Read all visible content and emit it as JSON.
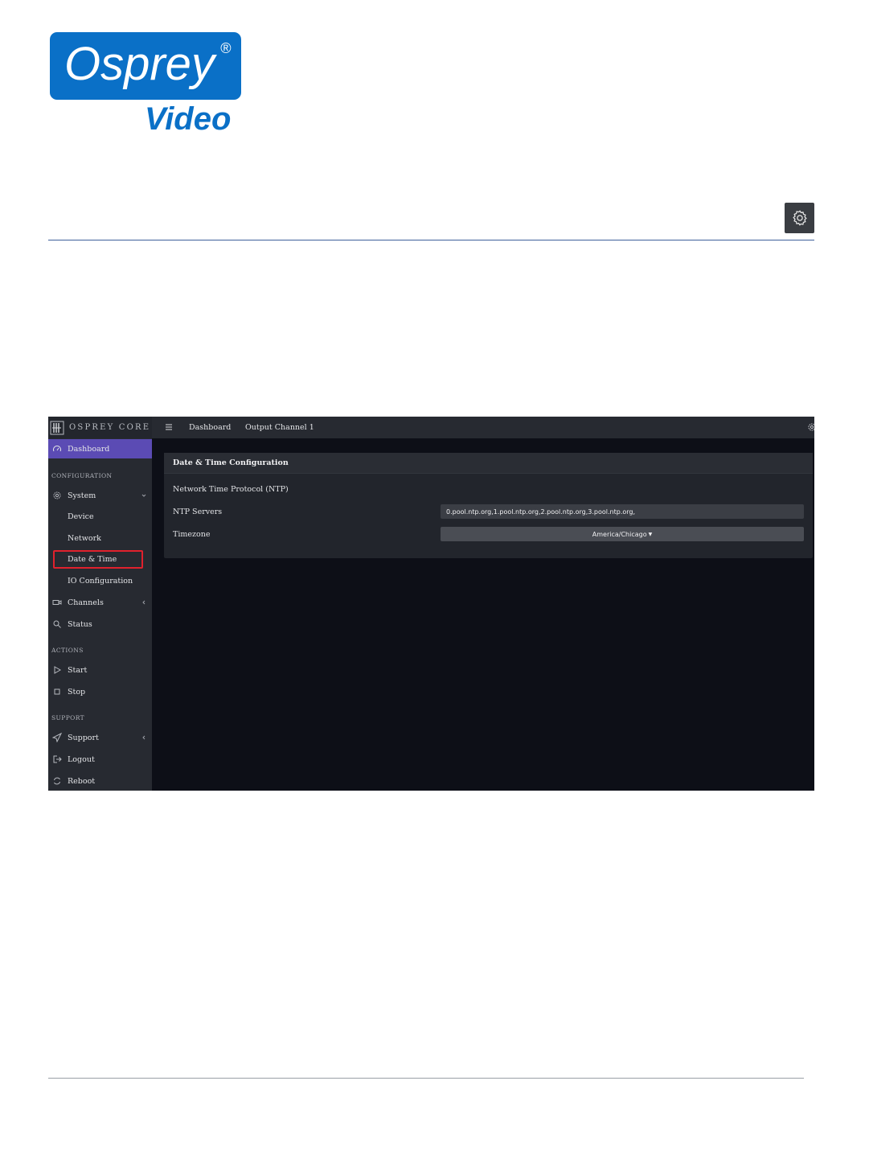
{
  "logo": {
    "primary": "Osprey",
    "registered": "®",
    "secondary": "Video"
  },
  "colors": {
    "brand_blue": "#0a70c7",
    "active_nav": "#5b4bb4",
    "highlight": "#e0212d"
  },
  "app": {
    "brand": "OSPREY CORE",
    "topbar": {
      "menu_icon": "hamburger-icon",
      "tabs": [
        "Dashboard",
        "Output Channel 1"
      ],
      "settings_icon": "gear-icon"
    },
    "sidebar": {
      "dashboard": "Dashboard",
      "sections": {
        "configuration": "CONFIGURATION",
        "actions": "ACTIONS",
        "support": "SUPPORT"
      },
      "system": "System",
      "system_children": [
        "Device",
        "Network",
        "Date & Time",
        "IO Configuration"
      ],
      "channels": "Channels",
      "status": "Status",
      "start": "Start",
      "stop": "Stop",
      "support_item": "Support",
      "logout": "Logout",
      "reboot": "Reboot"
    },
    "panel": {
      "title": "Date & Time Configuration",
      "ntp_heading": "Network Time Protocol (NTP)",
      "ntp_servers_label": "NTP Servers",
      "ntp_servers_value": "0.pool.ntp.org,1.pool.ntp.org,2.pool.ntp.org,3.pool.ntp.org,",
      "timezone_label": "Timezone",
      "timezone_value": "America/Chicago"
    }
  }
}
